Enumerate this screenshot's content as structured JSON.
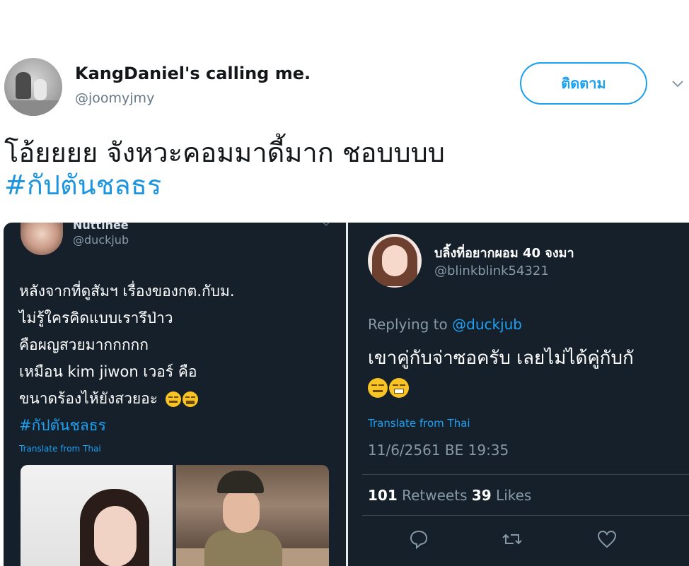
{
  "tweet": {
    "display_name": "KangDaniel's calling me.",
    "handle": "@joomyjmy",
    "follow_label": "ติดตาม",
    "text_line1": "โอ้ยยยย จังหวะคอมมาดี้มาก ชอบบบบ",
    "hashtag": "#กัปตันชลธร"
  },
  "left_screenshot": {
    "name": "Nuttinee",
    "handle": "@duckjub",
    "lines": [
      "หลังจากที่ดูสัมฯ เรื่องของกต.กับม.",
      "ไม่รู้ใครคิดแบบเรารึป่าว",
      "คือผญสวยมากกกกก",
      "เหมือน kim jiwon เวอร์ คือ",
      "ขนาดร้องไห้ยังสวยอะ"
    ],
    "hashtag": "#กัปตันชลธร",
    "translate": "Translate from Thai",
    "emoji_icons": [
      "flushed-face-icon",
      "laughing-tears-face-icon"
    ]
  },
  "right_screenshot": {
    "name": "บลิ้งที่อยากผอม 40 จงมา",
    "handle": "@blinkblink54321",
    "replying_prefix": "Replying to",
    "replying_mention": "@duckjub",
    "text": "เขาคู่กับจ่าซอครับ เลยไม่ได้คู่กับกั",
    "emoji_icons": [
      "expressionless-face-icon",
      "grimacing-face-icon"
    ],
    "translate": "Translate from Thai",
    "date": "11/6/2561 BE 19:35",
    "retweets_count": "101",
    "retweets_label": "Retweets",
    "likes_count": "39",
    "likes_label": "Likes",
    "action_icons": [
      "reply-icon",
      "retweet-icon",
      "like-icon"
    ]
  },
  "colors": {
    "accent": "#1da1f2",
    "hashtag": "#1b95e0",
    "dark_bg": "#15202b",
    "muted": "#8899a6"
  }
}
